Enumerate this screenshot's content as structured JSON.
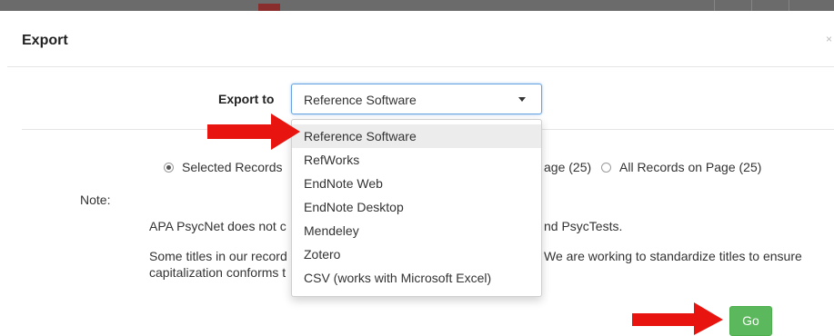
{
  "modal": {
    "title": "Export",
    "close_glyph": "×"
  },
  "export_to": {
    "label": "Export to",
    "selected": "Reference Software",
    "options": [
      "Reference Software",
      "RefWorks",
      "EndNote Web",
      "EndNote Desktop",
      "Mendeley",
      "Zotero",
      "CSV (works with Microsoft Excel)"
    ]
  },
  "records": {
    "selected_label": "Selected Records",
    "page_partial_label": "age (25)",
    "all_label": "All Records on Page (25)"
  },
  "note": {
    "label": "Note:",
    "line1_left": "APA PsycNet does not c",
    "line1_right": "nd PsycTests.",
    "line2_left": "Some titles in our record",
    "line2_right": "We are working to standardize titles to ensure",
    "line3_left": "capitalization conforms t"
  },
  "actions": {
    "go_label": "Go"
  },
  "colors": {
    "arrow": "#e8140f",
    "go": "#5cb85c",
    "focus": "#66a3e0"
  },
  "icons": {
    "dropdown": "caret-down-icon",
    "annotation": "red-arrow-icon"
  }
}
